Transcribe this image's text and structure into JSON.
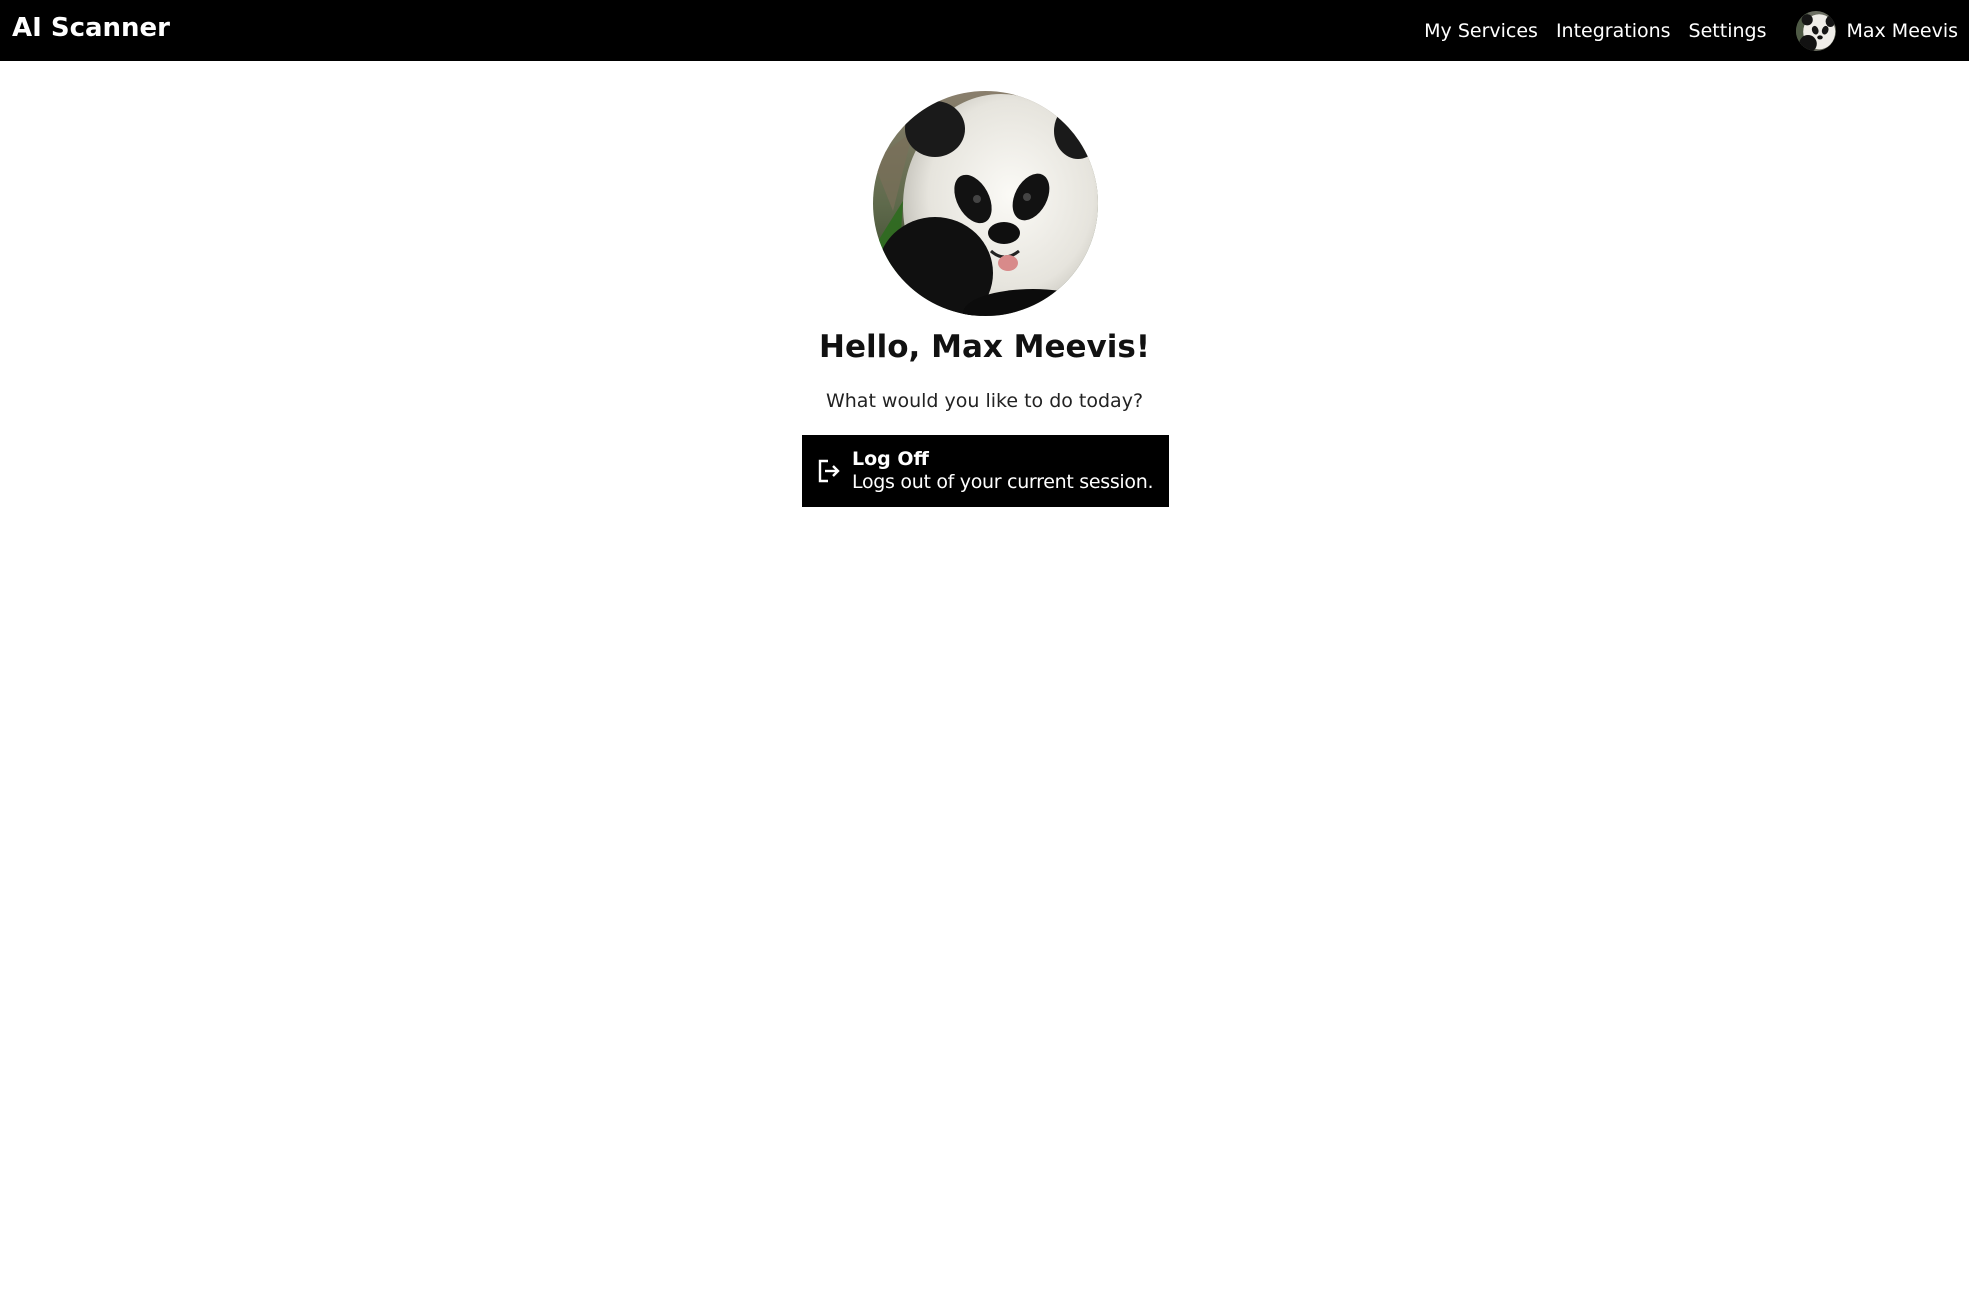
{
  "header": {
    "brand": "AI Scanner",
    "nav": [
      {
        "label": "My Services"
      },
      {
        "label": "Integrations"
      },
      {
        "label": "Settings"
      }
    ],
    "user": {
      "name": "Max Meevis",
      "avatar_icon": "panda-avatar"
    }
  },
  "main": {
    "greeting": "Hello, Max Meevis!",
    "subtitle": "What would you like to do today?",
    "actions": [
      {
        "title": "Log Off",
        "description": "Logs out of your current session.",
        "icon": "log-out-icon"
      }
    ]
  },
  "colors": {
    "header_bg": "#000000",
    "header_text": "#ffffff",
    "card_bg": "#000000",
    "page_bg": "#ffffff"
  }
}
